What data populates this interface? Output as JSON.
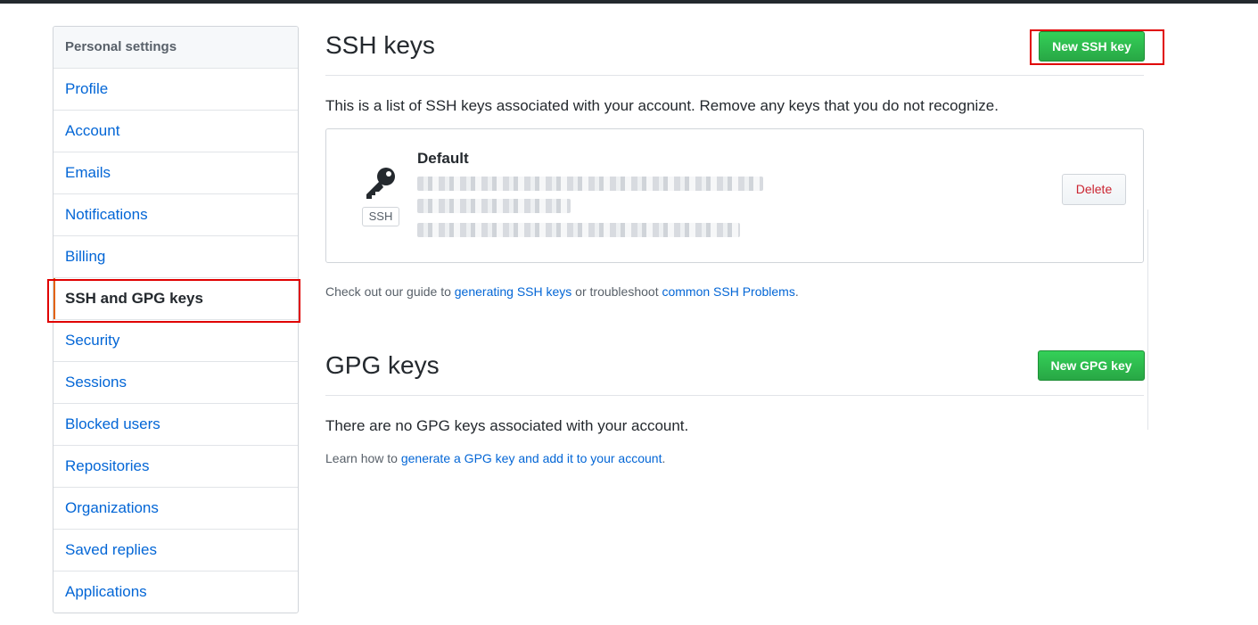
{
  "sidebar": {
    "header": "Personal settings",
    "items": [
      {
        "label": "Profile"
      },
      {
        "label": "Account"
      },
      {
        "label": "Emails"
      },
      {
        "label": "Notifications"
      },
      {
        "label": "Billing"
      },
      {
        "label": "SSH and GPG keys",
        "selected": true
      },
      {
        "label": "Security"
      },
      {
        "label": "Sessions"
      },
      {
        "label": "Blocked users"
      },
      {
        "label": "Repositories"
      },
      {
        "label": "Organizations"
      },
      {
        "label": "Saved replies"
      },
      {
        "label": "Applications"
      }
    ]
  },
  "ssh": {
    "title": "SSH keys",
    "new_button": "New SSH key",
    "description": "This is a list of SSH keys associated with your account. Remove any keys that you do not recognize.",
    "key": {
      "name": "Default",
      "type_label": "SSH",
      "delete_label": "Delete"
    },
    "guide": {
      "prefix": "Check out our guide to ",
      "link1": "generating SSH keys",
      "middle": " or troubleshoot ",
      "link2": "common SSH Problems",
      "suffix": "."
    }
  },
  "gpg": {
    "title": "GPG keys",
    "new_button": "New GPG key",
    "empty_text": "There are no GPG keys associated with your account.",
    "learn": {
      "prefix": "Learn how to ",
      "link": "generate a GPG key and add it to your account",
      "suffix": "."
    }
  },
  "colors": {
    "link": "#0366d6",
    "green": "#28a745",
    "danger": "#cb2431",
    "annotation": "#e00000"
  }
}
